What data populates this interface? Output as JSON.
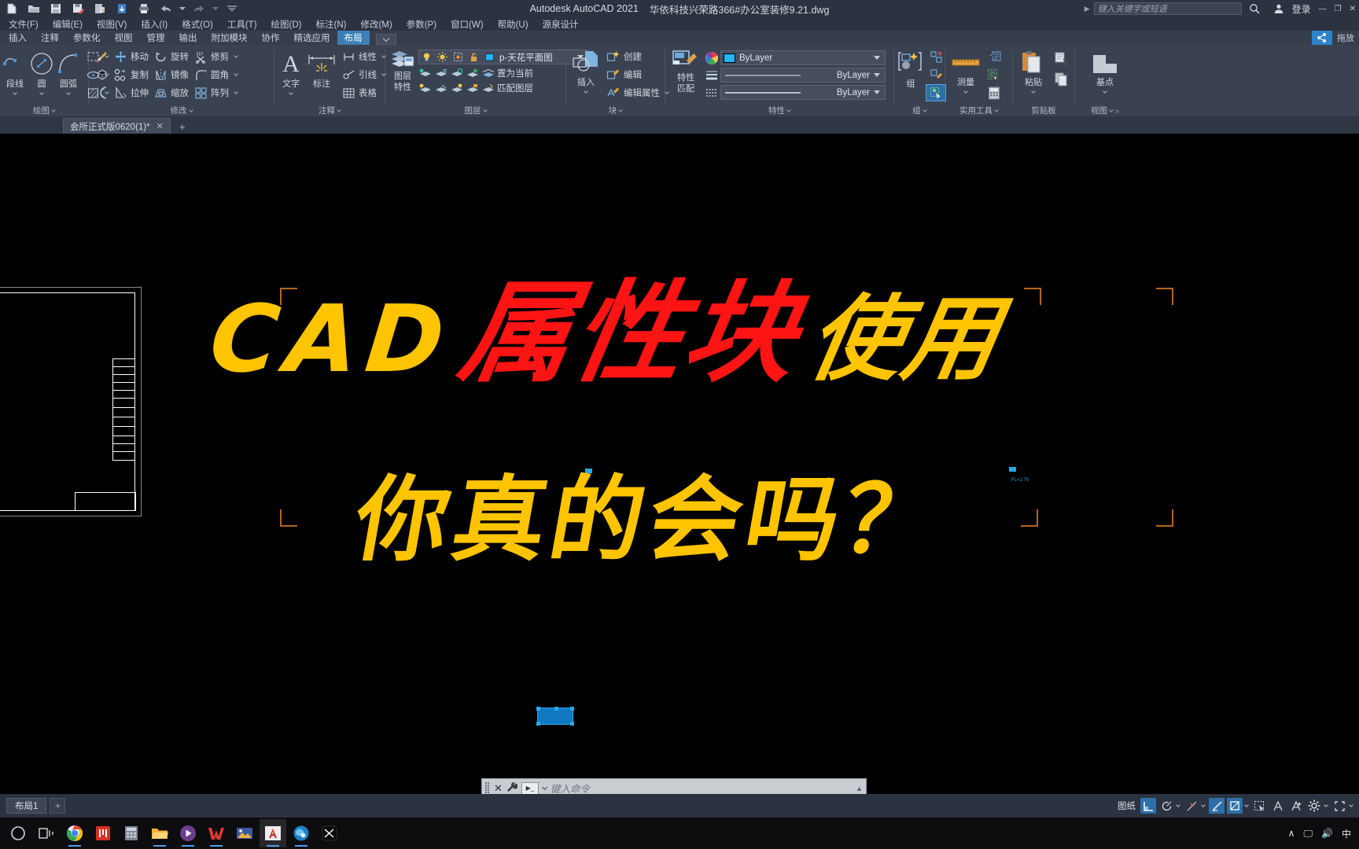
{
  "titlebar": {
    "app_title": "Autodesk AutoCAD 2021",
    "file_name": "华依科技兴荣路366#办公室装修9.21.dwg",
    "quick_access": [
      {
        "name": "new-file-icon",
        "tip": "新建"
      },
      {
        "name": "open-file-icon",
        "tip": "打开"
      },
      {
        "name": "save-icon",
        "tip": "保存"
      },
      {
        "name": "save-as-icon",
        "tip": "另存为"
      },
      {
        "name": "export-icon",
        "tip": "输出"
      },
      {
        "name": "cloud-sync-icon",
        "tip": "同步"
      },
      {
        "name": "print-icon",
        "tip": "打印"
      },
      {
        "name": "undo-icon",
        "tip": "放弃"
      },
      {
        "name": "redo-icon",
        "tip": "重做"
      },
      {
        "name": "qat-dropdown-icon",
        "tip": "自定义快速访问工具栏"
      }
    ],
    "search_placeholder": "键入关键字或短语",
    "login_label": "登录",
    "window_minimize": "—",
    "window_restore": "❐",
    "window_close": "✕"
  },
  "menubar": {
    "items": [
      "文件(F)",
      "编辑(E)",
      "视图(V)",
      "插入(I)",
      "格式(O)",
      "工具(T)",
      "绘图(D)",
      "标注(N)",
      "修改(M)",
      "参数(P)",
      "窗口(W)",
      "帮助(U)",
      "源泉设计"
    ]
  },
  "ribbon_tabs": {
    "items": [
      "插入",
      "注释",
      "参数化",
      "视图",
      "管理",
      "输出",
      "附加模块",
      "协作",
      "精选应用",
      "布局"
    ],
    "active": "布局",
    "drag_label": "拖放"
  },
  "ribbon": {
    "panels": [
      {
        "title": "绘图",
        "big_buttons": [
          {
            "label": "段线",
            "icon": "polyline-icon"
          },
          {
            "label": "圆",
            "icon": "circle-icon"
          },
          {
            "label": "圆弧",
            "icon": "arc-icon"
          }
        ],
        "small_buttons": [
          {
            "icon": "rectangle-icon"
          },
          {
            "icon": "ellipse-icon"
          },
          {
            "icon": "hatch-icon"
          }
        ]
      },
      {
        "title": "修改",
        "rows": [
          [
            {
              "label": "移动",
              "icon": "move-icon"
            },
            {
              "label": "旋转",
              "icon": "rotate-icon"
            },
            {
              "label": "修剪",
              "icon": "trim-icon",
              "caret": true
            }
          ],
          [
            {
              "label": "复制",
              "icon": "copy-icon"
            },
            {
              "label": "镜像",
              "icon": "mirror-icon"
            },
            {
              "label": "圆角",
              "icon": "fillet-icon",
              "caret": true
            }
          ],
          [
            {
              "label": "拉伸",
              "icon": "stretch-icon"
            },
            {
              "label": "缩放",
              "icon": "scale-icon"
            },
            {
              "label": "阵列",
              "icon": "array-icon",
              "caret": true
            }
          ]
        ],
        "extra": [
          {
            "icon": "brush-icon"
          },
          {
            "icon": "explode-icon"
          },
          {
            "icon": "offset-icon"
          }
        ]
      },
      {
        "title": "注释",
        "big_buttons": [
          {
            "label": "文字",
            "icon": "text-icon"
          },
          {
            "label": "标注",
            "icon": "dimension-icon"
          }
        ],
        "rows": [
          {
            "label": "线性",
            "icon": "linear-dim-icon",
            "caret": true
          },
          {
            "label": "引线",
            "icon": "leader-icon",
            "caret": true
          },
          {
            "label": "表格",
            "icon": "table-icon"
          }
        ]
      },
      {
        "title": "图层",
        "big_button": {
          "label1": "图层",
          "label2": "特性",
          "icon": "layer-properties-icon"
        },
        "layer_name": "p-天花平面图",
        "layer_toggles": [
          "lightbulb-icon",
          "sun-icon",
          "freeze-icon",
          "lock-icon",
          "color-swatch-icon"
        ],
        "rows": [
          {
            "label": "置为当前",
            "icon": "set-current-layer-icon"
          },
          {
            "label": "匹配图层",
            "icon": "match-layer-icon"
          }
        ]
      },
      {
        "title": "块",
        "big_button": {
          "label": "插入",
          "icon": "insert-block-icon"
        },
        "rows": [
          {
            "label": "创建",
            "icon": "create-block-icon"
          },
          {
            "label": "编辑",
            "icon": "edit-block-icon"
          },
          {
            "label": "编辑属性",
            "icon": "edit-attribute-icon",
            "caret": true
          }
        ]
      },
      {
        "title": "特性",
        "big_button": {
          "label1": "特性",
          "label2": "匹配",
          "icon": "match-properties-icon"
        },
        "combos": [
          {
            "value": "ByLayer",
            "icon": "color-swatch-icon"
          },
          {
            "value": "ByLayer",
            "icon": "linetype-icon"
          },
          {
            "value": "ByLayer",
            "icon": "lineweight-icon"
          }
        ]
      },
      {
        "title": "组",
        "big_button": {
          "label": "组",
          "icon": "group-icon"
        },
        "small_buttons": [
          {
            "icon": "ungroup-icon"
          },
          {
            "icon": "edit-group-icon"
          },
          {
            "icon": "group-selection-toggle-icon",
            "active": true
          }
        ]
      },
      {
        "title": "实用工具",
        "big_button": {
          "label": "测量",
          "icon": "measure-ruler-icon"
        },
        "small_buttons": [
          {
            "icon": "quick-select-icon"
          },
          {
            "icon": "select-all-icon"
          },
          {
            "icon": "calculator-icon"
          }
        ]
      },
      {
        "title": "剪贴板",
        "big_button": {
          "label": "粘贴",
          "icon": "paste-icon"
        },
        "small_buttons": [
          {
            "icon": "cut-icon"
          },
          {
            "icon": "copy-clip-icon"
          }
        ]
      },
      {
        "title": "视图",
        "big_button": {
          "label": "基点",
          "icon": "base-point-icon"
        }
      }
    ]
  },
  "file_tabs": {
    "tabs": [
      {
        "label": "会所正式版0620(1)*",
        "close": "✕",
        "active": true
      }
    ],
    "add_label": "+"
  },
  "canvas": {
    "headline_part1": "CAD",
    "headline_part2": "属性块",
    "headline_part3": "使用",
    "headline_line2": "你真的会吗？",
    "color_yellow": "#ffc400",
    "color_red": "#ff1414",
    "background": "#000000"
  },
  "command_line": {
    "placeholder": "键入命令",
    "close_label": "✕",
    "wrench_icon": "wrench-icon",
    "history_icon": "command-history-icon"
  },
  "statusbar": {
    "layout_tab": "布局1",
    "add_layout": "+",
    "paper_label": "图纸",
    "tools": [
      {
        "name": "ortho-icon",
        "active": true
      },
      {
        "name": "polar-tracking-icon",
        "active": false
      },
      {
        "name": "osnap-icon",
        "active": false
      },
      {
        "name": "object-snap-tracking-icon",
        "active": true
      },
      {
        "name": "annotation-visibility-icon",
        "active": true
      },
      {
        "name": "selection-cycling-icon",
        "active": false
      },
      {
        "name": "annotation-scale-icon",
        "active": false
      },
      {
        "name": "workspace-switch-icon",
        "active": false
      },
      {
        "name": "settings-gear-icon",
        "active": false
      }
    ]
  },
  "taskbar": {
    "items": [
      {
        "name": "start-icon"
      },
      {
        "name": "task-view-icon"
      },
      {
        "name": "chrome-icon",
        "running": true
      },
      {
        "name": "wps-presentation-icon",
        "running": false
      },
      {
        "name": "calculator-icon",
        "running": false
      },
      {
        "name": "file-explorer-icon",
        "running": true
      },
      {
        "name": "media-player-icon",
        "running": true
      },
      {
        "name": "wps-office-icon",
        "running": true
      },
      {
        "name": "photos-icon",
        "running": false
      },
      {
        "name": "autocad-icon",
        "running": true,
        "active": true
      },
      {
        "name": "camtasia-icon",
        "running": true
      },
      {
        "name": "capcut-icon",
        "running": false
      }
    ],
    "tray": [
      "∧",
      "🖵",
      "🔊",
      "中"
    ]
  }
}
